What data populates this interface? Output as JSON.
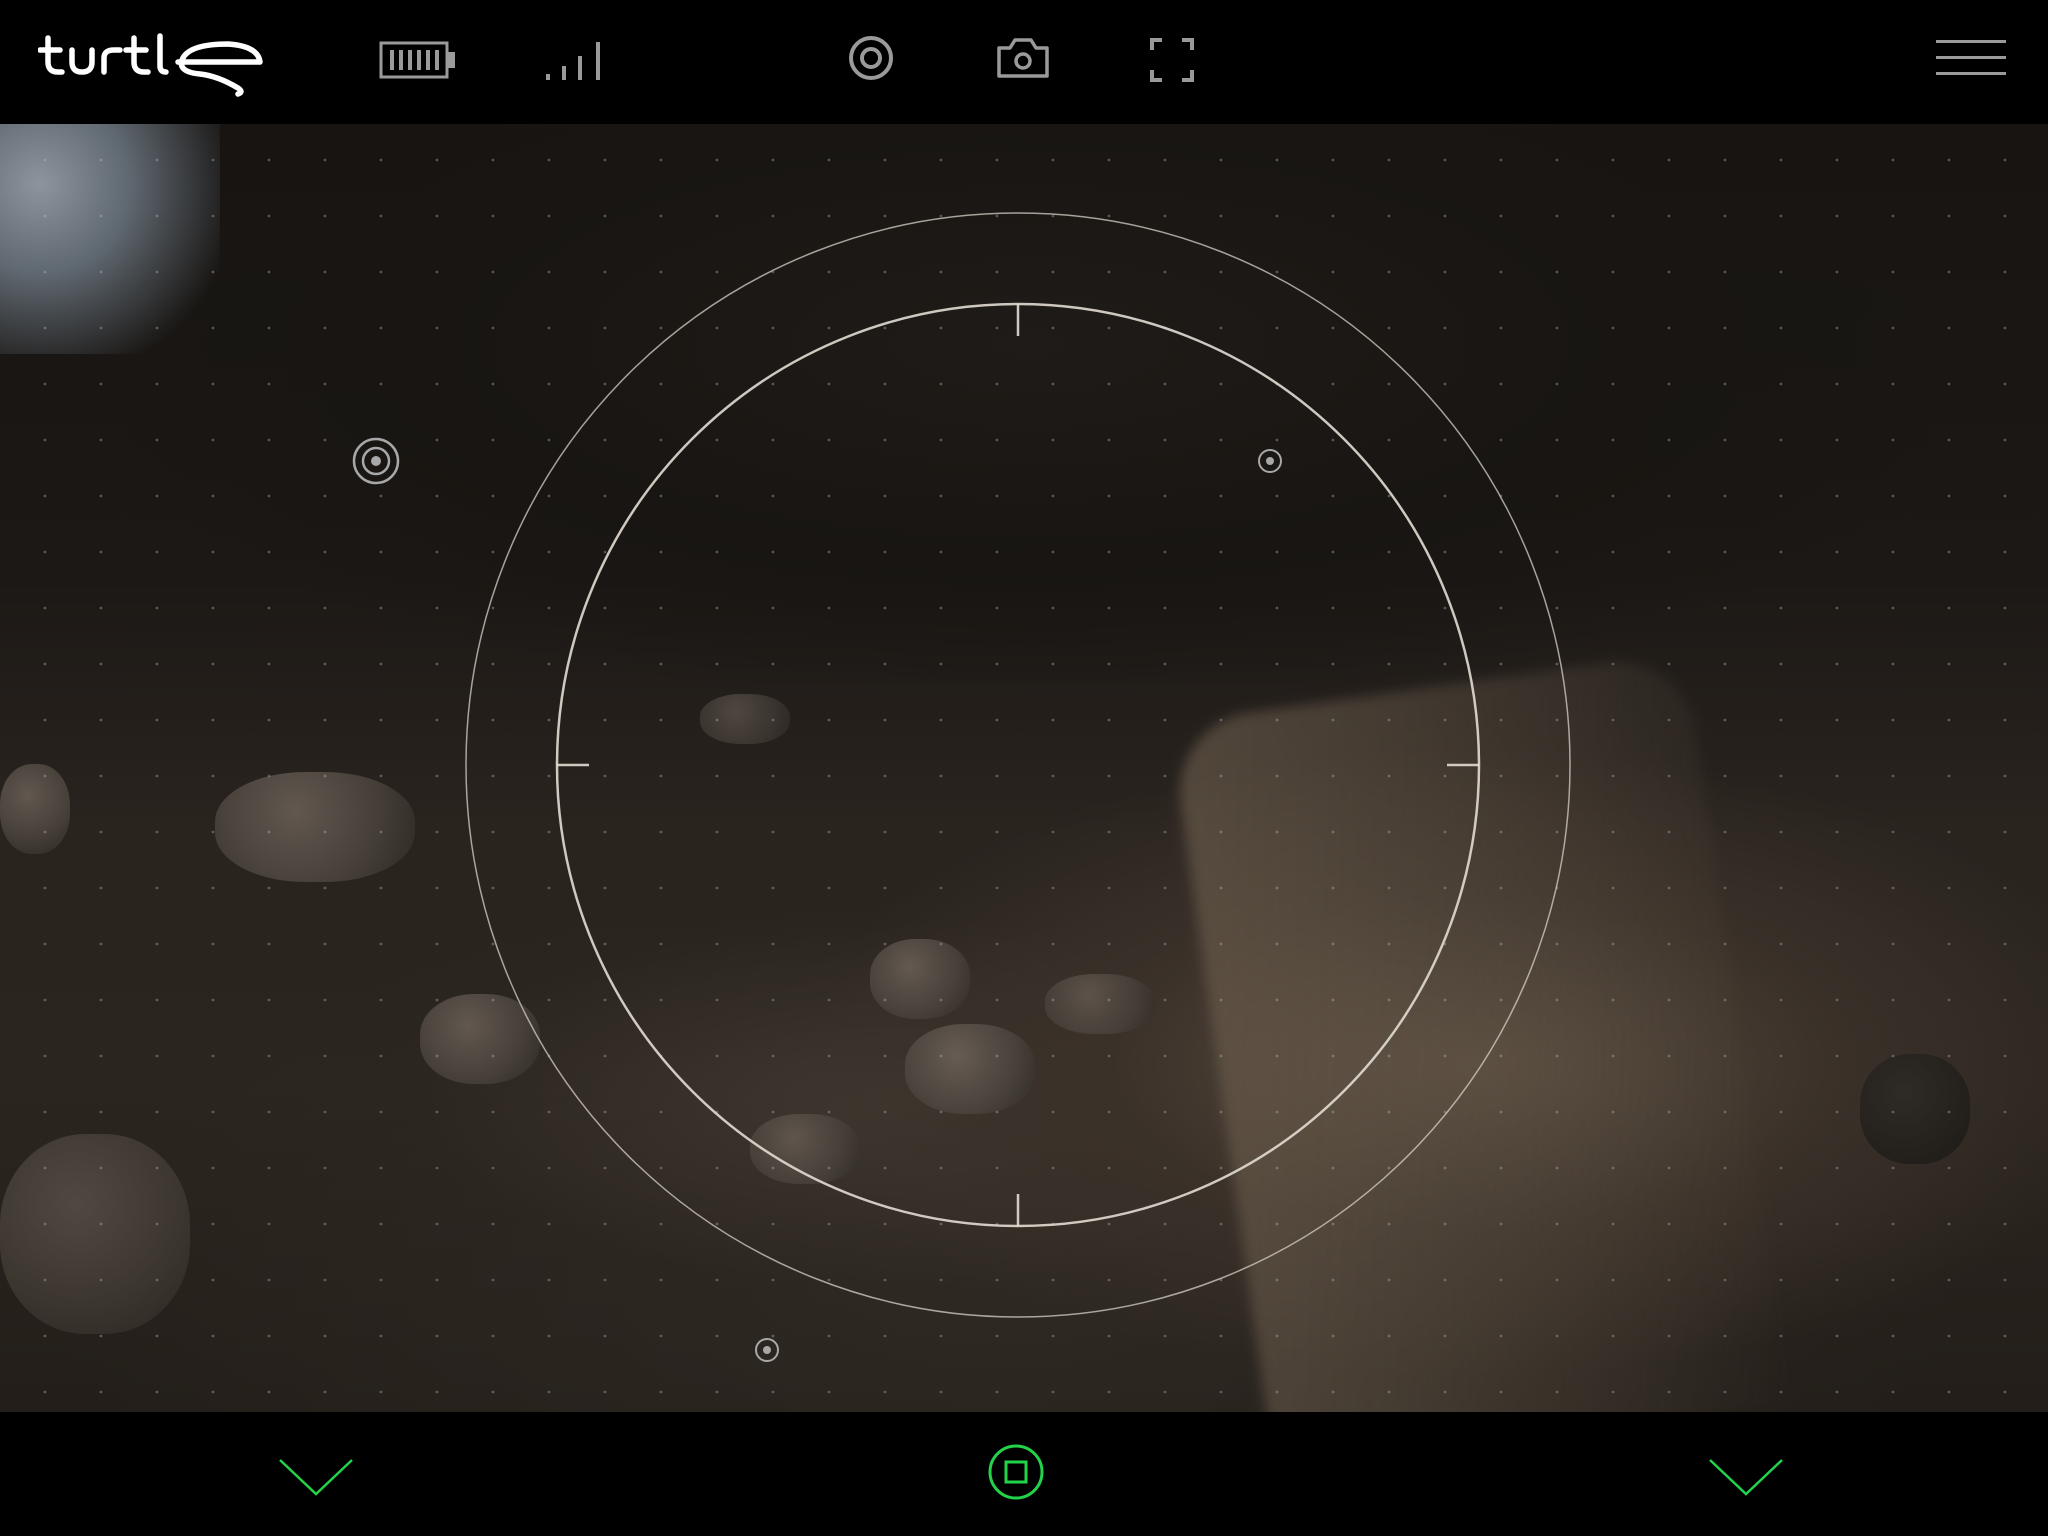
{
  "app": {
    "brand": "turtle"
  },
  "colors": {
    "accent": "#22d34a",
    "icon": "#9a9a9a",
    "reticle": "#d8d0c8",
    "background": "#000000"
  },
  "topbar": {
    "icons": [
      "battery-icon",
      "signal-icon",
      "view-icon",
      "camera-icon",
      "fullscreen-icon",
      "menu-icon"
    ]
  },
  "bottombar": {
    "icons": [
      "chevron-down-icon",
      "record-stop-icon",
      "chevron-down-icon"
    ]
  }
}
